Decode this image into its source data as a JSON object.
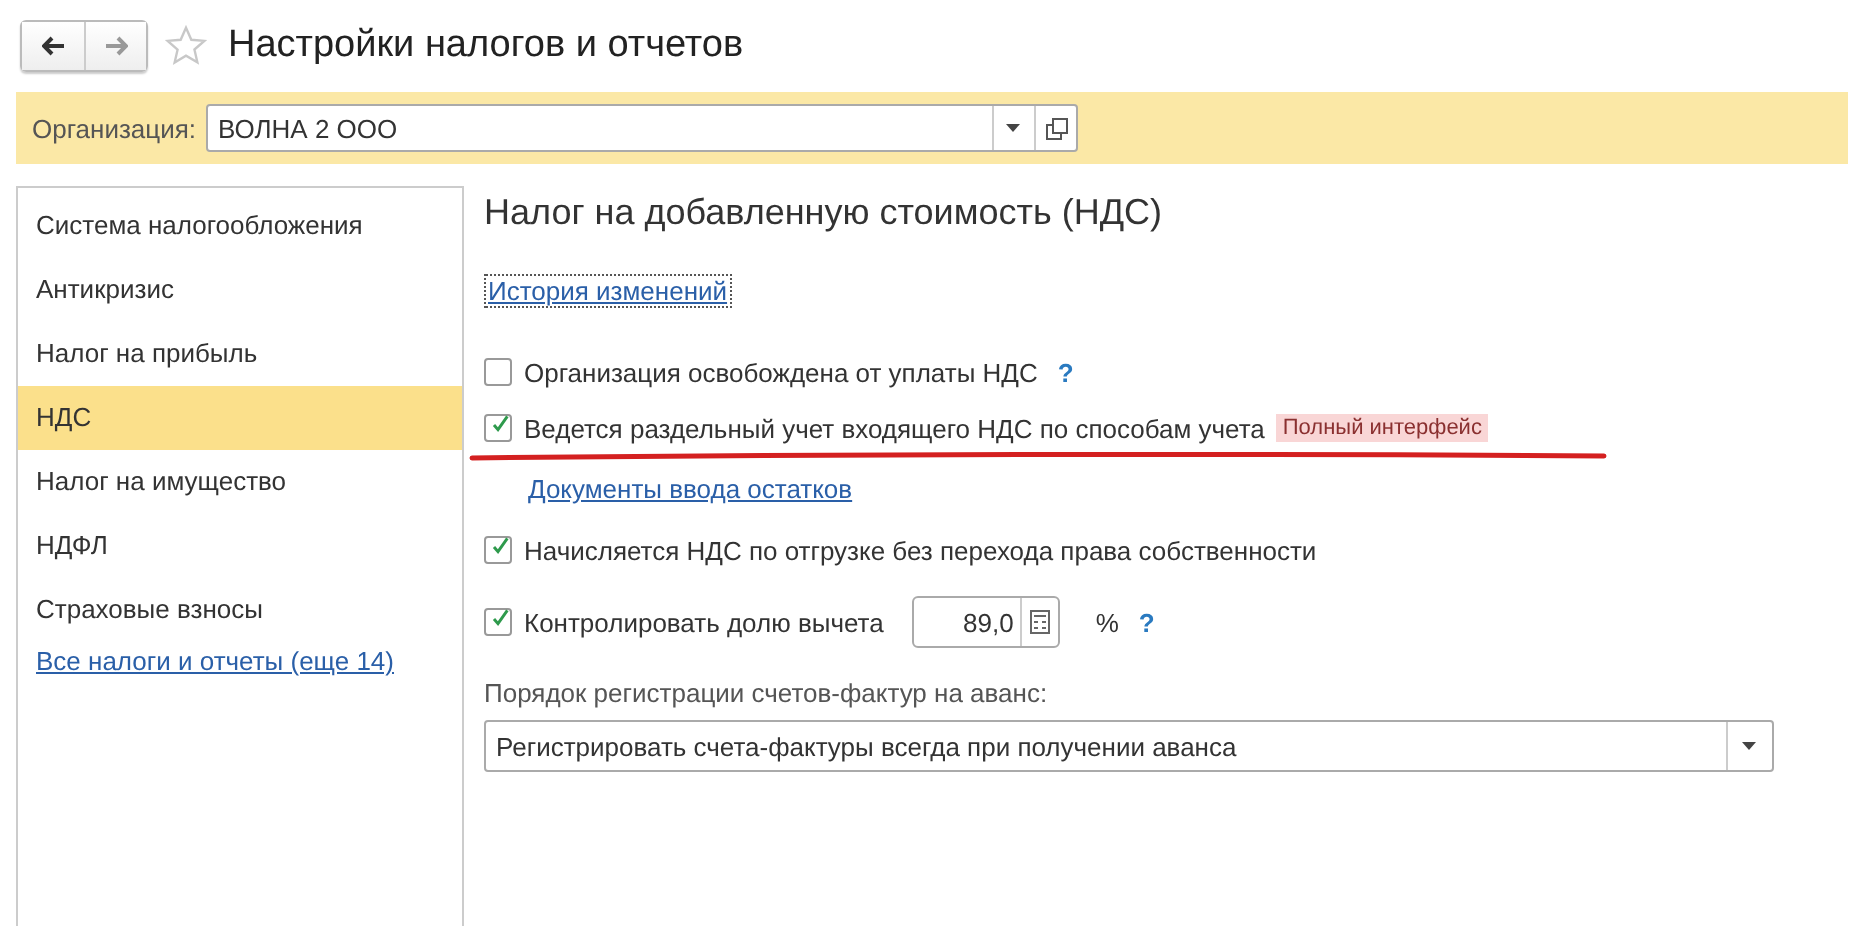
{
  "window": {
    "title": "Настройки налогов и отчетов"
  },
  "organization": {
    "label": "Организация:",
    "value": "ВОЛНА 2 ООО"
  },
  "sidebar": {
    "items": [
      {
        "label": "Система налогообложения",
        "selected": false
      },
      {
        "label": "Антикризис",
        "selected": false
      },
      {
        "label": "Налог на прибыль",
        "selected": false
      },
      {
        "label": "НДС",
        "selected": true
      },
      {
        "label": "Налог на имущество",
        "selected": false
      },
      {
        "label": "НДФЛ",
        "selected": false
      },
      {
        "label": "Страховые взносы",
        "selected": false
      }
    ],
    "link": "Все налоги и отчеты (еще 14)"
  },
  "section": {
    "title": "Налог на добавленную стоимость (НДС)",
    "history_link": "История изменений",
    "options": [
      {
        "kind": "checkbox",
        "label": "Организация освобождена от уплаты НДС",
        "checked": false,
        "help": "?"
      },
      {
        "kind": "checkbox",
        "label": "Ведется раздельный учет входящего НДС по способам учета",
        "checked": true,
        "badge": "Полный интерфейс"
      },
      {
        "kind": "link",
        "label": "Документы ввода остатков"
      },
      {
        "kind": "checkbox",
        "label": "Начисляется НДС по отгрузке без перехода права собственности",
        "checked": true
      },
      {
        "kind": "number",
        "label": "Контролировать долю вычета",
        "checked": true,
        "value": "89,0",
        "unit": "%",
        "help": "?"
      }
    ],
    "invoice_order": {
      "label": "Порядок регистрации счетов-фактур на аванс:",
      "value": "Регистрировать счета-фактуры всегда при получении аванса"
    }
  }
}
